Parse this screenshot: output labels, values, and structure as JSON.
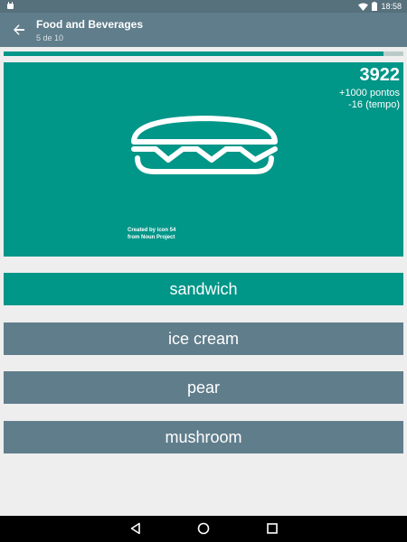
{
  "status": {
    "time": "18:58"
  },
  "header": {
    "title": "Food and Beverages",
    "subtitle": "5 de 10"
  },
  "progress": {
    "value": 0.95
  },
  "card": {
    "score": "3922",
    "bonus_points": "+1000 pontos",
    "time_penalty": "-16 (tempo)",
    "icon": "sandwich-icon",
    "credit_line1": "Created by icon 54",
    "credit_line2": "from Noun Project"
  },
  "answers": [
    {
      "label": "sandwich",
      "state": "correct"
    },
    {
      "label": "ice cream",
      "state": "normal"
    },
    {
      "label": "pear",
      "state": "normal"
    },
    {
      "label": "mushroom",
      "state": "normal"
    }
  ],
  "colors": {
    "accent": "#009688",
    "bar": "#607d8b",
    "status": "#56707c"
  }
}
